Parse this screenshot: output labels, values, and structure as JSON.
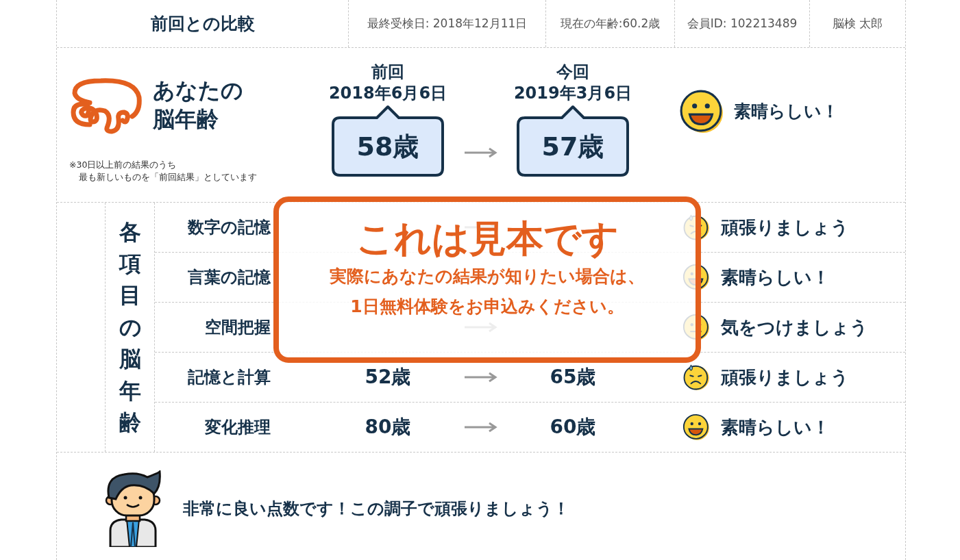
{
  "header": {
    "title": "前回との比較",
    "info": [
      "最終受検日: 2018年12月11日",
      "現在の年齢:60.2歳",
      "会員ID: 102213489",
      "脳検 太郎"
    ]
  },
  "brain_age": {
    "title_lines": [
      "あなたの",
      "脳年齢"
    ],
    "note_lines": [
      "※30日以上前の結果のうち",
      "最も新しいものを「前回結果」としています"
    ],
    "previous": {
      "label": "前回",
      "date": "2018年6月6日",
      "age": "58歳"
    },
    "current": {
      "label": "今回",
      "date": "2019年3月6日",
      "age": "57歳"
    },
    "kind": "great",
    "comment": "素晴らしい！"
  },
  "items": {
    "title": "各項目の脳年齢",
    "rows": [
      {
        "name": "数字の記憶",
        "kind": "worry",
        "comment": "頑張りましょう"
      },
      {
        "name": "言葉の記憶",
        "kind": "great",
        "comment": "素晴らしい！"
      },
      {
        "name": "空間把握",
        "kind": "neutral",
        "comment": "気をつけましょう"
      },
      {
        "name": "記憶と計算",
        "previous": "52歳",
        "current": "65歳",
        "kind": "worry",
        "comment": "頑張りましょう"
      },
      {
        "name": "変化推理",
        "previous": "80歳",
        "current": "60歳",
        "kind": "great",
        "comment": "素晴らしい！"
      }
    ]
  },
  "advice": {
    "message": "非常に良い点数です！この調子で頑張りましょう！"
  },
  "sample_notice": {
    "title": "これは見本です",
    "lines": [
      "実際にあなたの結果が知りたい場合は、",
      "1日無料体験をお申込みください。"
    ]
  }
}
